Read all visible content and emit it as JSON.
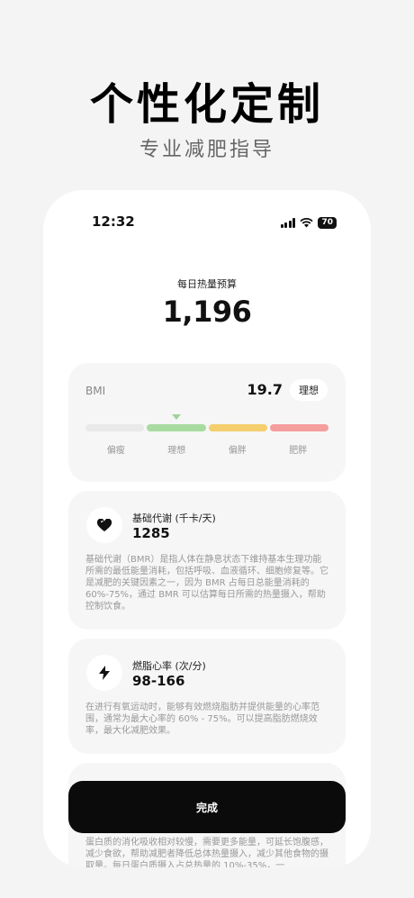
{
  "hero": {
    "title": "个性化定制",
    "subtitle": "专业减肥指导"
  },
  "status_bar": {
    "time": "12:32",
    "battery": "70"
  },
  "budget": {
    "label": "每日热量预算",
    "value": "1,196"
  },
  "bmi": {
    "label": "BMI",
    "value": "19.7",
    "status": "理想",
    "segments": [
      {
        "label": "偏瘦",
        "color": "#e9e9e9"
      },
      {
        "label": "理想",
        "color": "#a8dba0"
      },
      {
        "label": "偏胖",
        "color": "#f5cf6e"
      },
      {
        "label": "肥胖",
        "color": "#f49e9e"
      }
    ]
  },
  "cards": [
    {
      "icon": "heart-icon",
      "title": "基础代谢 (千卡/天)",
      "value": "1285",
      "desc": "基础代谢（BMR）是指人体在静息状态下维持基本生理功能所需的最低能量消耗，包括呼吸、血液循环、细胞修复等。它是减肥的关键因素之一，因为 BMR 占每日总能量消耗的 60%-75%，通过 BMR 可以估算每日所需的热量摄入，帮助控制饮食。"
    },
    {
      "icon": "lightning-icon",
      "title": "燃脂心率 (次/分)",
      "value": "98-166",
      "desc": "在进行有氧运动时，能够有效燃烧脂肪并提供能量的心率范围，通常为最大心率的 60% - 75%。可以提高脂肪燃烧效率，最大化减肥效果。"
    },
    {
      "icon": "",
      "title": "",
      "value": "",
      "desc": "蛋白质的消化吸收相对较慢，需要更多能量，可延长饱腹感，减少食欲，帮助减肥者降低总体热量摄入，减少其他食物的摄取量。每日蛋白质摄入占总热量的 10%-35%，一"
    }
  ],
  "done_button": "完成"
}
